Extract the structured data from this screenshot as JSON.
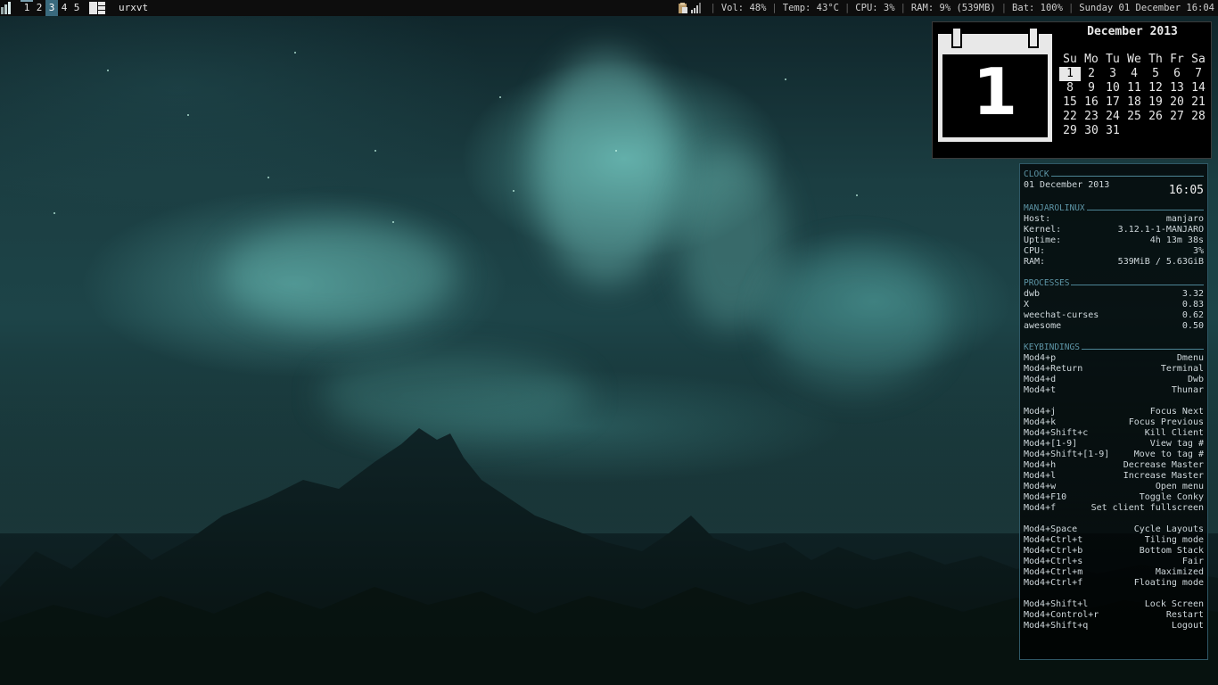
{
  "topbar": {
    "tags": [
      {
        "label": "1",
        "active": false
      },
      {
        "label": "2",
        "active": false
      },
      {
        "label": "3",
        "active": true
      },
      {
        "label": "4",
        "active": false
      },
      {
        "label": "5",
        "active": false
      }
    ],
    "window_title": "urxvt",
    "status": {
      "vol": "Vol: 48%",
      "temp": "Temp: 43°C",
      "cpu": "CPU: 3%",
      "ram": "RAM: 9% (539MB)",
      "bat": "Bat: 100%",
      "datetime": "Sunday 01 December 16:04"
    },
    "separator": "|"
  },
  "calendar": {
    "day_number": "1",
    "month_title": "December 2013",
    "weekdays": [
      "Su",
      "Mo",
      "Tu",
      "We",
      "Th",
      "Fr",
      "Sa"
    ],
    "weeks": [
      [
        "1",
        "2",
        "3",
        "4",
        "5",
        "6",
        "7"
      ],
      [
        "8",
        "9",
        "10",
        "11",
        "12",
        "13",
        "14"
      ],
      [
        "15",
        "16",
        "17",
        "18",
        "19",
        "20",
        "21"
      ],
      [
        "22",
        "23",
        "24",
        "25",
        "26",
        "27",
        "28"
      ],
      [
        "29",
        "30",
        "31",
        "",
        "",
        "",
        ""
      ]
    ],
    "today": "1"
  },
  "conky": {
    "clock": {
      "header": "CLOCK",
      "date": "01 December 2013",
      "time": "16:05"
    },
    "system": {
      "header": "MANJAROLINUX",
      "rows": [
        {
          "k": "Host:",
          "v": "manjaro"
        },
        {
          "k": "Kernel:",
          "v": "3.12.1-1-MANJARO"
        },
        {
          "k": "Uptime:",
          "v": "4h 13m 38s"
        },
        {
          "k": "CPU:",
          "v": "3%"
        },
        {
          "k": "RAM:",
          "v": "539MiB / 5.63GiB"
        }
      ]
    },
    "processes": {
      "header": "PROCESSES",
      "rows": [
        {
          "k": "dwb",
          "v": "3.32"
        },
        {
          "k": "X",
          "v": "0.83"
        },
        {
          "k": "weechat-curses",
          "v": "0.62"
        },
        {
          "k": "awesome",
          "v": "0.50"
        }
      ]
    },
    "keybindings": {
      "header": "KEYBINDINGS",
      "groups": [
        [
          {
            "k": "Mod4+p",
            "v": "Dmenu"
          },
          {
            "k": "Mod4+Return",
            "v": "Terminal"
          },
          {
            "k": "Mod4+d",
            "v": "Dwb"
          },
          {
            "k": "Mod4+t",
            "v": "Thunar"
          }
        ],
        [
          {
            "k": "Mod4+j",
            "v": "Focus Next"
          },
          {
            "k": "Mod4+k",
            "v": "Focus Previous"
          },
          {
            "k": "Mod4+Shift+c",
            "v": "Kill Client"
          },
          {
            "k": "Mod4+[1-9]",
            "v": "View tag #"
          },
          {
            "k": "Mod4+Shift+[1-9]",
            "v": "Move to tag #"
          },
          {
            "k": "Mod4+h",
            "v": "Decrease Master"
          },
          {
            "k": "Mod4+l",
            "v": "Increase Master"
          },
          {
            "k": "Mod4+w",
            "v": "Open menu"
          },
          {
            "k": "Mod4+F10",
            "v": "Toggle Conky"
          },
          {
            "k": "Mod4+f",
            "v": "Set client fullscreen"
          }
        ],
        [
          {
            "k": "Mod4+Space",
            "v": "Cycle Layouts"
          },
          {
            "k": "Mod4+Ctrl+t",
            "v": "Tiling mode"
          },
          {
            "k": "Mod4+Ctrl+b",
            "v": "Bottom Stack"
          },
          {
            "k": "Mod4+Ctrl+s",
            "v": "Fair"
          },
          {
            "k": "Mod4+Ctrl+m",
            "v": "Maximized"
          },
          {
            "k": "Mod4+Ctrl+f",
            "v": "Floating mode"
          }
        ],
        [
          {
            "k": "Mod4+Shift+l",
            "v": "Lock Screen"
          },
          {
            "k": "Mod4+Control+r",
            "v": "Restart"
          },
          {
            "k": "Mod4+Shift+q",
            "v": "Logout"
          }
        ]
      ]
    }
  },
  "icons": {
    "layout": "layout-tile-icon",
    "tiling": "tiling-layout-icon",
    "tray_clipboard": "clipboard-icon",
    "tray_network": "signal-bars-icon"
  },
  "colors": {
    "active_tag": "#3a6a7e",
    "conky_accent": "#5d95a6"
  }
}
